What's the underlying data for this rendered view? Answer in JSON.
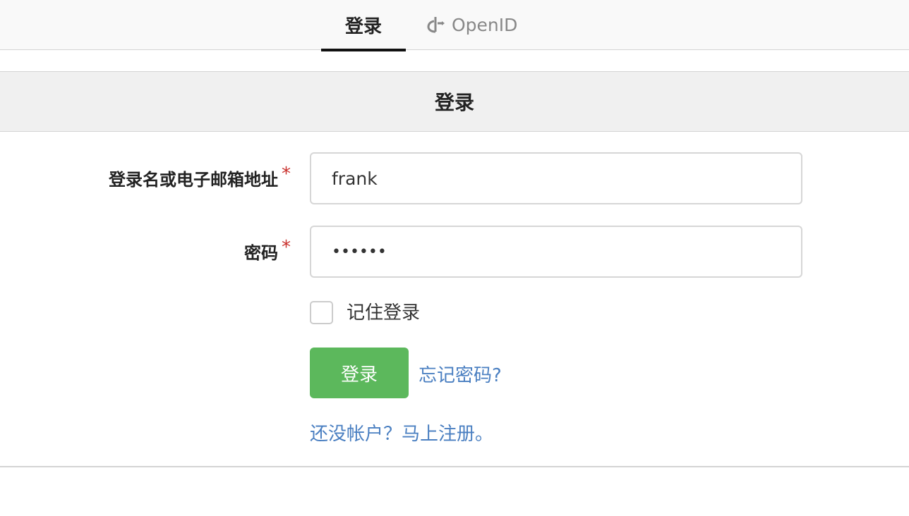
{
  "tabs": {
    "login_label": "登录",
    "openid_label": "OpenID"
  },
  "panel": {
    "title": "登录"
  },
  "form": {
    "login_label": "登录名或电子邮箱地址",
    "login_value": "frank",
    "password_label": "密码",
    "password_value": "••••••",
    "required_mark": "*",
    "remember_label": "记住登录",
    "remember_checked": false,
    "submit_label": "登录",
    "forgot_link": "忘记密码?",
    "register_link": "还没帐户？马上注册。"
  },
  "colors": {
    "primary_button": "#5cb85c",
    "link": "#4a7fc1",
    "required": "#c9302c"
  }
}
